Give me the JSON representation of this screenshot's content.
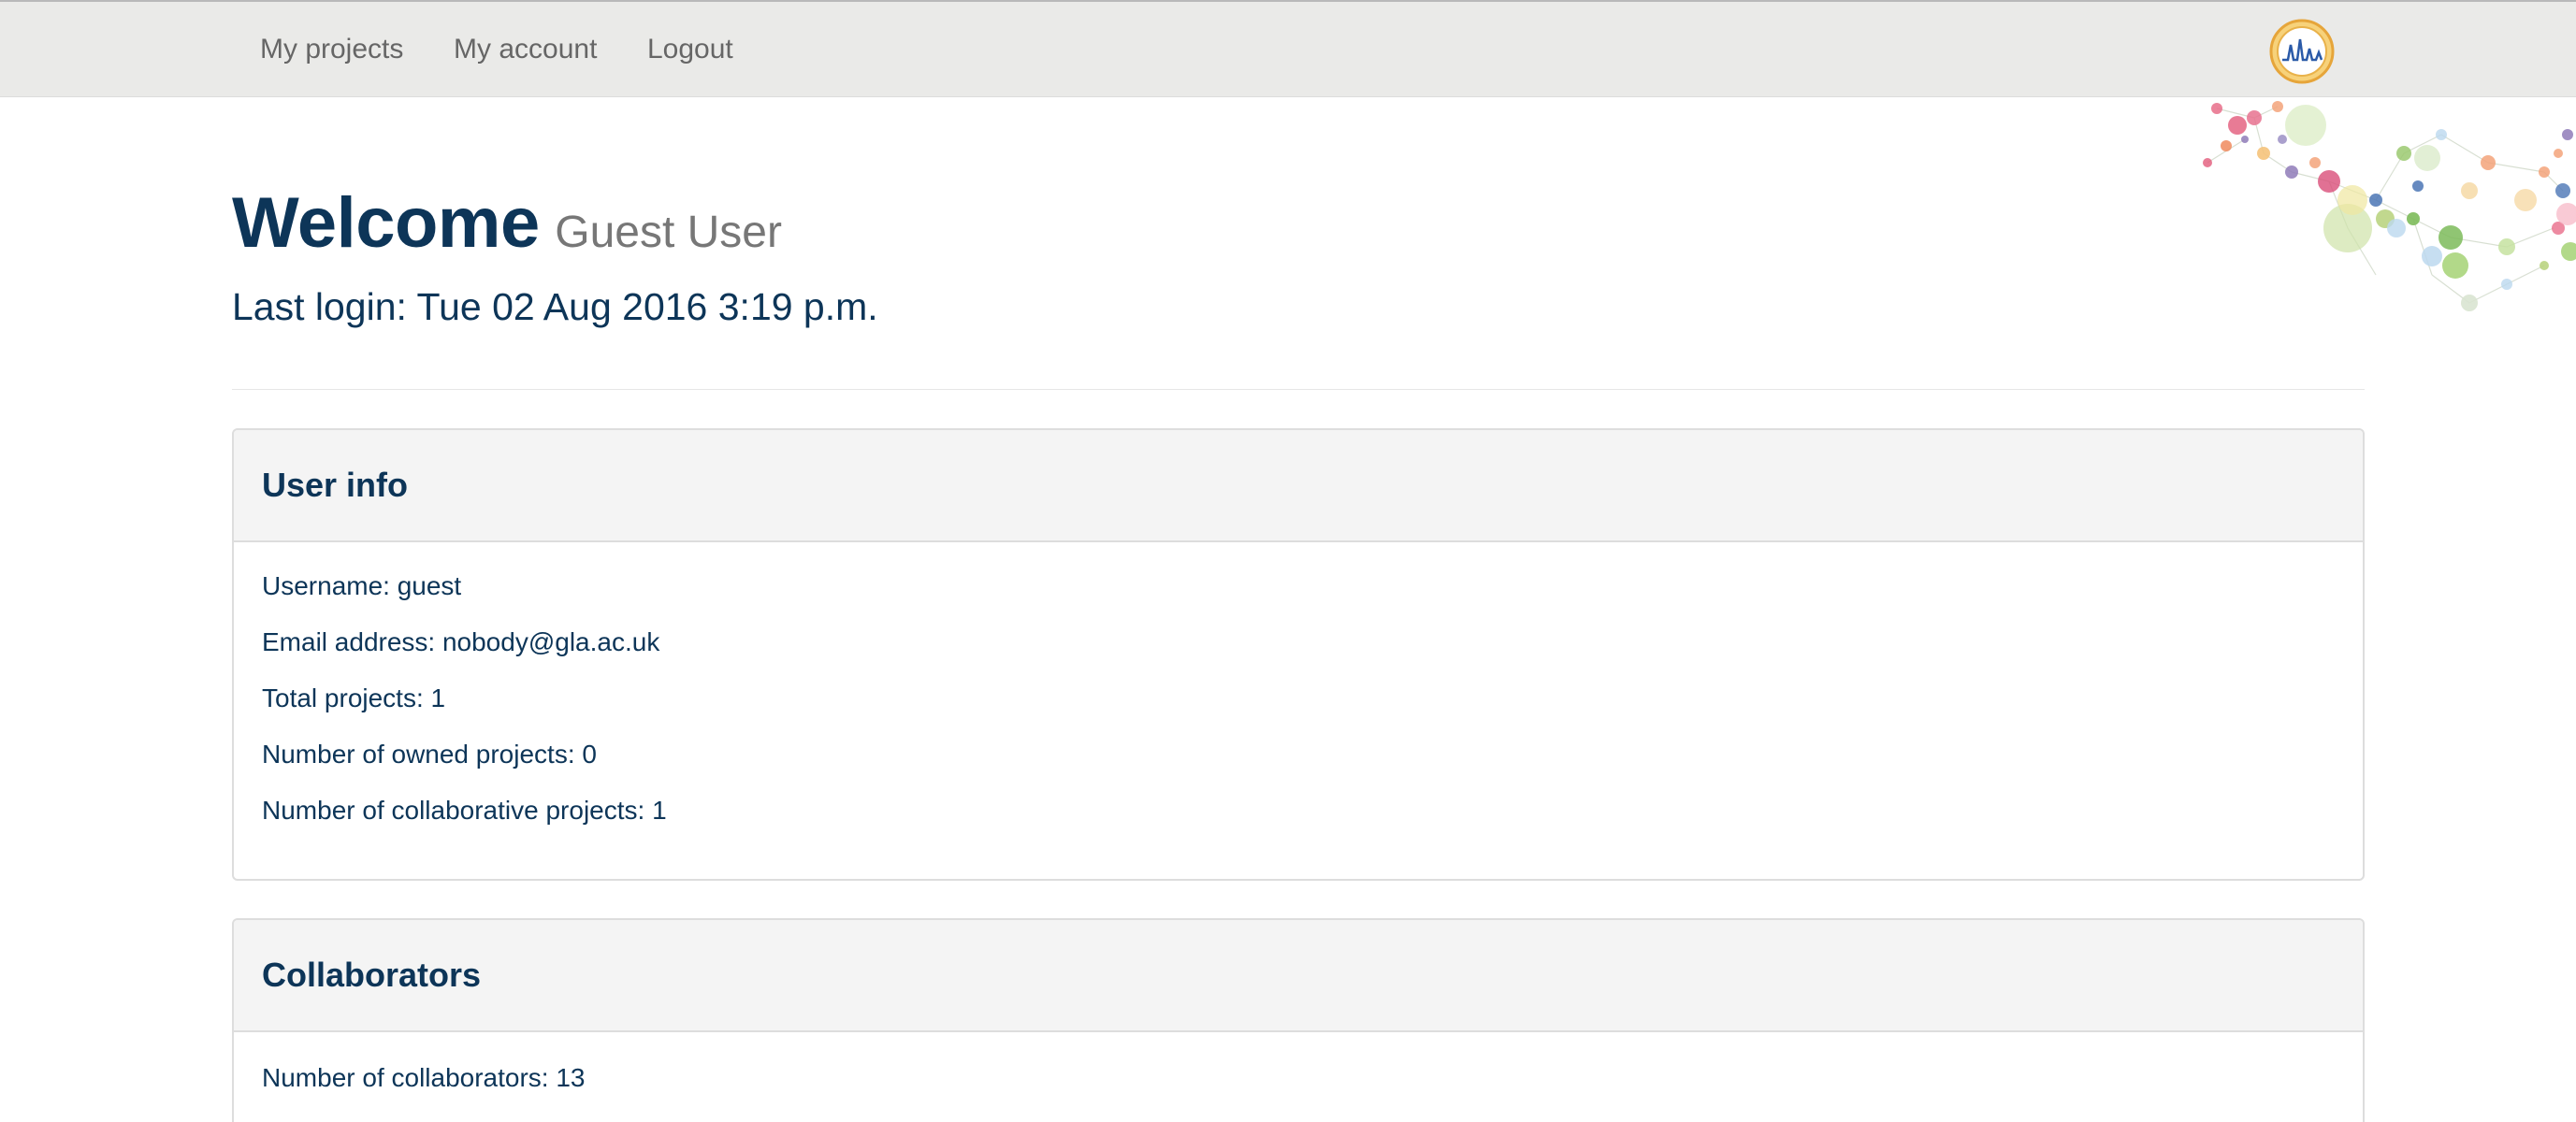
{
  "nav": {
    "items": [
      {
        "label": "My projects"
      },
      {
        "label": "My account"
      },
      {
        "label": "Logout"
      }
    ],
    "logo_icon": "spectrum-peaks-logo"
  },
  "header": {
    "title": "Welcome",
    "name": "Guest User",
    "last_login": "Last login: Tue 02 Aug 2016 3:19 p.m."
  },
  "user_info": {
    "title": "User info",
    "rows": [
      {
        "label": "Username:",
        "value": "guest"
      },
      {
        "label": "Email address:",
        "value": "nobody@gla.ac.uk"
      },
      {
        "label": "Total projects:",
        "value": "1"
      },
      {
        "label": "Number of owned projects:",
        "value": "0"
      },
      {
        "label": "Number of collaborative projects:",
        "value": "1"
      }
    ]
  },
  "collaborators": {
    "title": "Collaborators",
    "rows": [
      {
        "label": "Number of collaborators:",
        "value": "13"
      }
    ]
  },
  "colors": {
    "primary_text": "#0d3558",
    "navbar_bg": "#eaeae8",
    "panel_head_bg": "#f4f4f4",
    "muted_text": "#777777"
  }
}
